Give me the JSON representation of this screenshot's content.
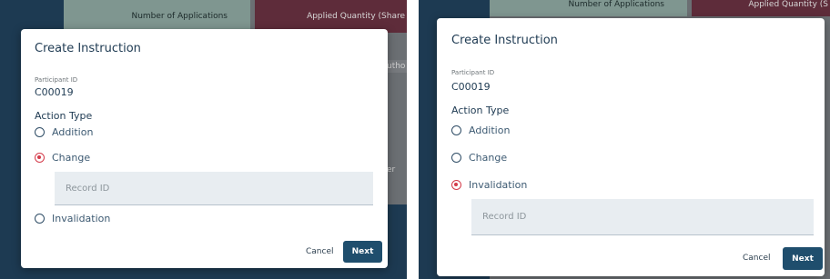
{
  "left": {
    "background": {
      "col1_header": "Number of Applications",
      "col2_header": "Applied Quantity (Share",
      "cell_fragment": "utho",
      "cell_fragment2": "er"
    },
    "dialog": {
      "title": "Create Instruction",
      "participant_label": "Participant ID",
      "participant_value": "C00019",
      "action_type_label": "Action Type",
      "options": [
        {
          "label": "Addition",
          "checked": false
        },
        {
          "label": "Change",
          "checked": true
        },
        {
          "label": "Invalidation",
          "checked": false
        }
      ],
      "record_placeholder": "Record ID",
      "cancel_label": "Cancel",
      "next_label": "Next"
    }
  },
  "right": {
    "background": {
      "col1_header": "Number of Applications",
      "col2_header": "Applied Quantity (S"
    },
    "dialog": {
      "title": "Create Instruction",
      "participant_label": "Participant ID",
      "participant_value": "C00019",
      "action_type_label": "Action Type",
      "options": [
        {
          "label": "Addition",
          "checked": false
        },
        {
          "label": "Change",
          "checked": false
        },
        {
          "label": "Invalidation",
          "checked": true
        }
      ],
      "record_placeholder": "Record ID",
      "cancel_label": "Cancel",
      "next_label": "Next"
    }
  },
  "colors": {
    "overlay": "#6b6f73",
    "primary_button": "#1f4e6d",
    "radio_selected": "#d43b4a",
    "text_primary": "#1e3a52"
  }
}
